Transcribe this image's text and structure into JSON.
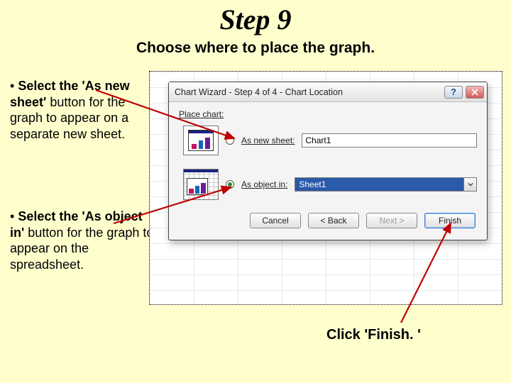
{
  "title": "Step 9",
  "subtitle": "Choose where to place the graph.",
  "instr1_html": "• <b>Select the 'As new sheet'</b> button for the graph to appear on a separate new sheet.",
  "instr2_html": "• <b>Select the 'As object in'</b> button for the graph to appear on the spreadsheet.",
  "instr3": "Click 'Finish. '",
  "dialog": {
    "title": "Chart Wizard - Step 4 of 4 - Chart Location",
    "place_label": "Place chart:",
    "option1": {
      "label": "As new sheet:",
      "value": "Chart1",
      "selected": false
    },
    "option2": {
      "label": "As object in:",
      "value": "Sheet1",
      "selected": true
    },
    "buttons": {
      "cancel": "Cancel",
      "back": "< Back",
      "next": "Next >",
      "finish": "Finish"
    }
  }
}
